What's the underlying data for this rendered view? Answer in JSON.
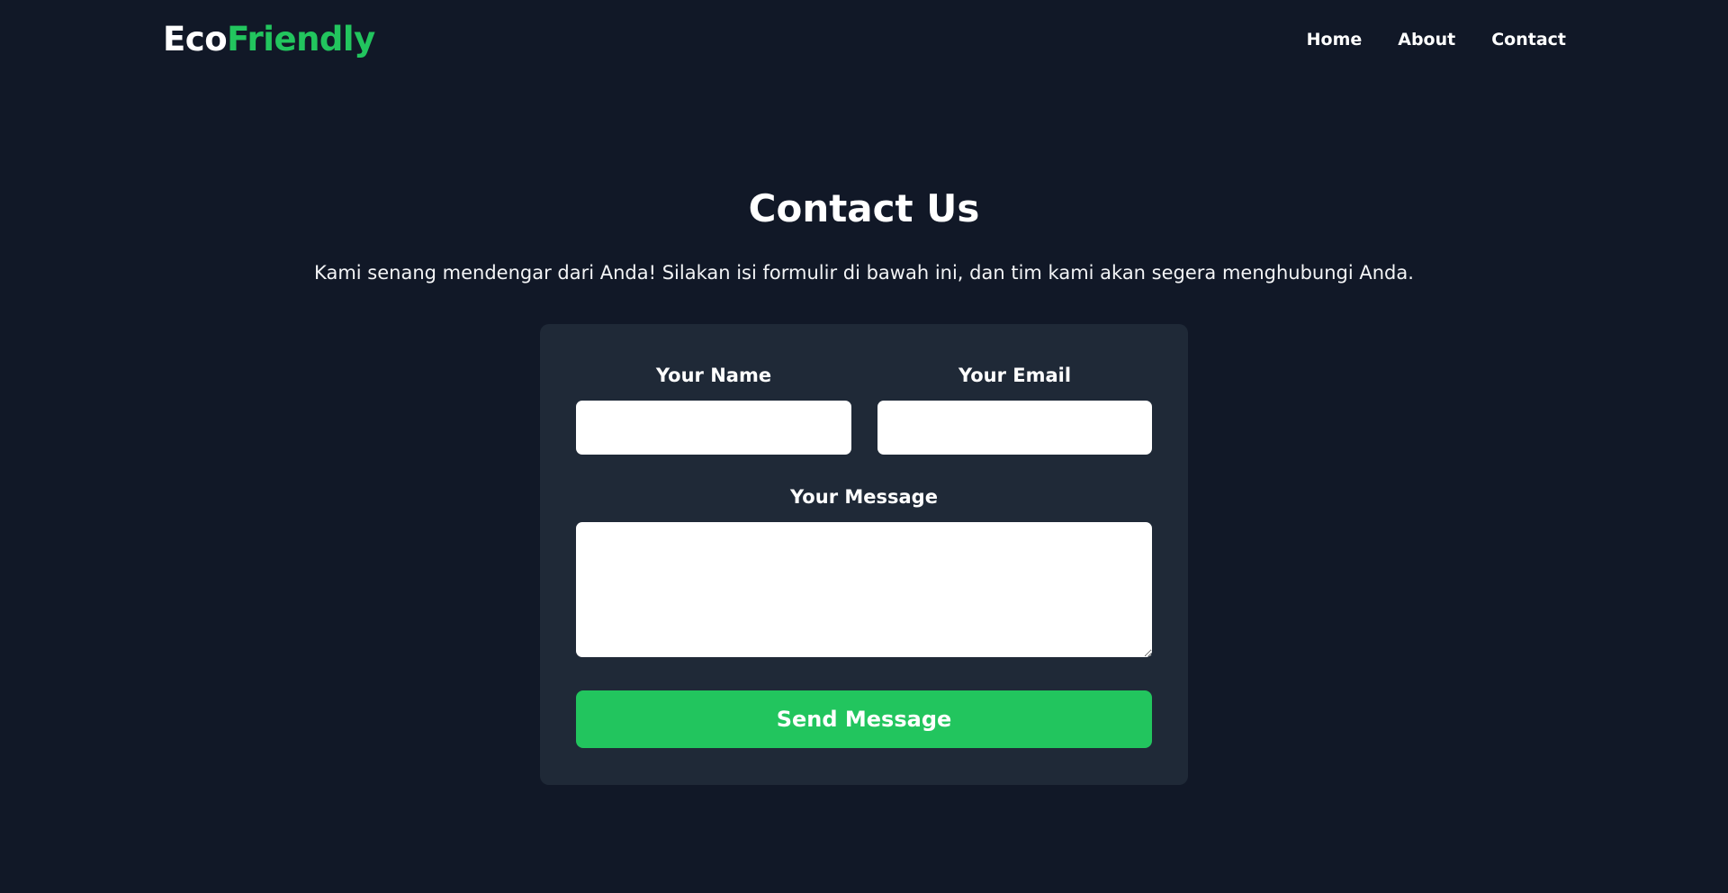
{
  "header": {
    "logo_part1": "Eco",
    "logo_part2": "Friendly",
    "nav": [
      {
        "label": "Home"
      },
      {
        "label": "About"
      },
      {
        "label": "Contact"
      }
    ]
  },
  "main": {
    "title": "Contact Us",
    "subtitle": "Kami senang mendengar dari Anda! Silakan isi formulir di bawah ini, dan tim kami akan segera menghubungi Anda."
  },
  "form": {
    "name_label": "Your Name",
    "name_value": "",
    "email_label": "Your Email",
    "email_value": "",
    "message_label": "Your Message",
    "message_value": "",
    "submit_label": "Send Message"
  },
  "colors": {
    "background": "#111827",
    "card": "#1f2937",
    "accent": "#22c55e",
    "text": "#ffffff"
  }
}
